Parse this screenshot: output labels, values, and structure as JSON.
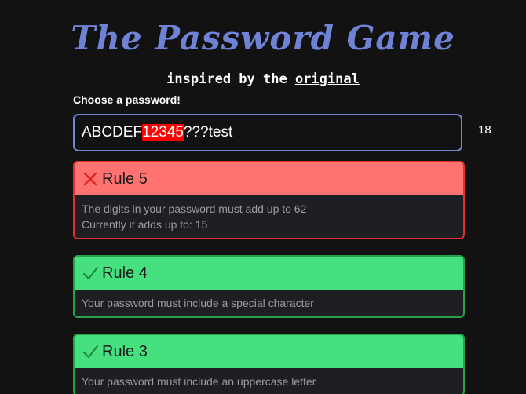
{
  "header": {
    "title": "The Password Game",
    "subtitle_prefix": "inspired by the ",
    "subtitle_link": "original"
  },
  "password": {
    "label": "Choose a password!",
    "value_before": "ABCDEF",
    "value_digits": "12345",
    "value_after": "???test",
    "char_count": "18"
  },
  "rules": [
    {
      "status": "fail",
      "title": "Rule 5",
      "line1": "The digits in your password must add up to 62",
      "line2": "Currently it adds up to: 15"
    },
    {
      "status": "pass",
      "title": "Rule 4",
      "line1": "Your password must include a special character"
    },
    {
      "status": "pass",
      "title": "Rule 3",
      "line1": "Your password must include an uppercase letter"
    }
  ],
  "colors": {
    "background": "#121212",
    "title": "#6f82d6",
    "input_border": "#7884d4",
    "fail_header": "#ff7272",
    "fail_border": "#e03030",
    "pass_header": "#46e07e",
    "pass_border": "#26a24c",
    "digit_highlight": "#ff0000"
  },
  "icons": {
    "fail": "cross-icon",
    "pass": "checkmark-icon"
  }
}
